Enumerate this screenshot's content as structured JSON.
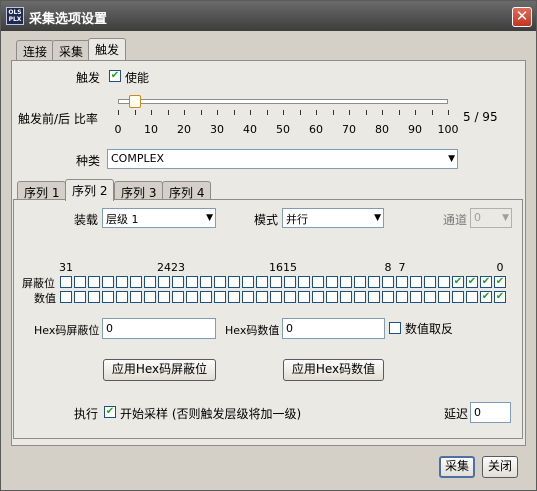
{
  "window": {
    "title": "采集选项设置",
    "app_icon_text": [
      "OLS",
      "PLX"
    ]
  },
  "top_tabs": [
    "连接",
    "采集",
    "触发"
  ],
  "trigger": {
    "label": "触发",
    "enable_label": "使能",
    "enable_checked": true,
    "ratio_label": "触发前/后 比率",
    "ratio_value_text": "5 / 95",
    "ratio_value": 5,
    "ratio_max": 100,
    "tick_labels": [
      "0",
      "10",
      "20",
      "30",
      "40",
      "50",
      "60",
      "70",
      "80",
      "90",
      "100"
    ],
    "type_label": "种类",
    "type_value": "COMPLEX"
  },
  "stage_tabs": [
    "序列 1",
    "序列 2",
    "序列 3",
    "序列 4"
  ],
  "stage": {
    "load_label": "装载",
    "load_value": "层级 1",
    "mode_label": "模式",
    "mode_value": "并行",
    "channel_label": "通道",
    "channel_value": "0",
    "bit_labels": [
      {
        "text": "31",
        "bit": 31
      },
      {
        "text": "24",
        "bit": 24
      },
      {
        "text": "23",
        "bit": 23
      },
      {
        "text": "16",
        "bit": 16
      },
      {
        "text": "15",
        "bit": 15
      },
      {
        "text": "8",
        "bit": 8
      },
      {
        "text": "7",
        "bit": 7
      },
      {
        "text": "0",
        "bit": 0
      }
    ],
    "mask_label": "屏蔽位",
    "value_label": "数值",
    "mask_checked_bits": [
      0,
      1,
      2,
      3
    ],
    "value_checked_bits": [
      0,
      1
    ],
    "hex_mask_label": "Hex码屏蔽位",
    "hex_mask_value": "0",
    "hex_value_label": "Hex码数值",
    "hex_value_value": "0",
    "invert_label": "数值取反",
    "invert_checked": false,
    "apply_mask_button": "应用Hex码屏蔽位",
    "apply_value_button": "应用Hex码数值",
    "exec_label": "执行",
    "start_capture_label": "开始采样 (否则触发层级将加一级)",
    "start_capture_checked": true,
    "delay_label": "延迟",
    "delay_value": "0"
  },
  "footer": {
    "capture_button": "采集",
    "close_button": "关闭"
  },
  "glyphs": {
    "check": "✔",
    "close": "✕",
    "dropdown": "▼"
  },
  "colors": {
    "titlebar": "#4a4a4a",
    "checkmark": "#21a121",
    "close_button": "#c2351f"
  }
}
